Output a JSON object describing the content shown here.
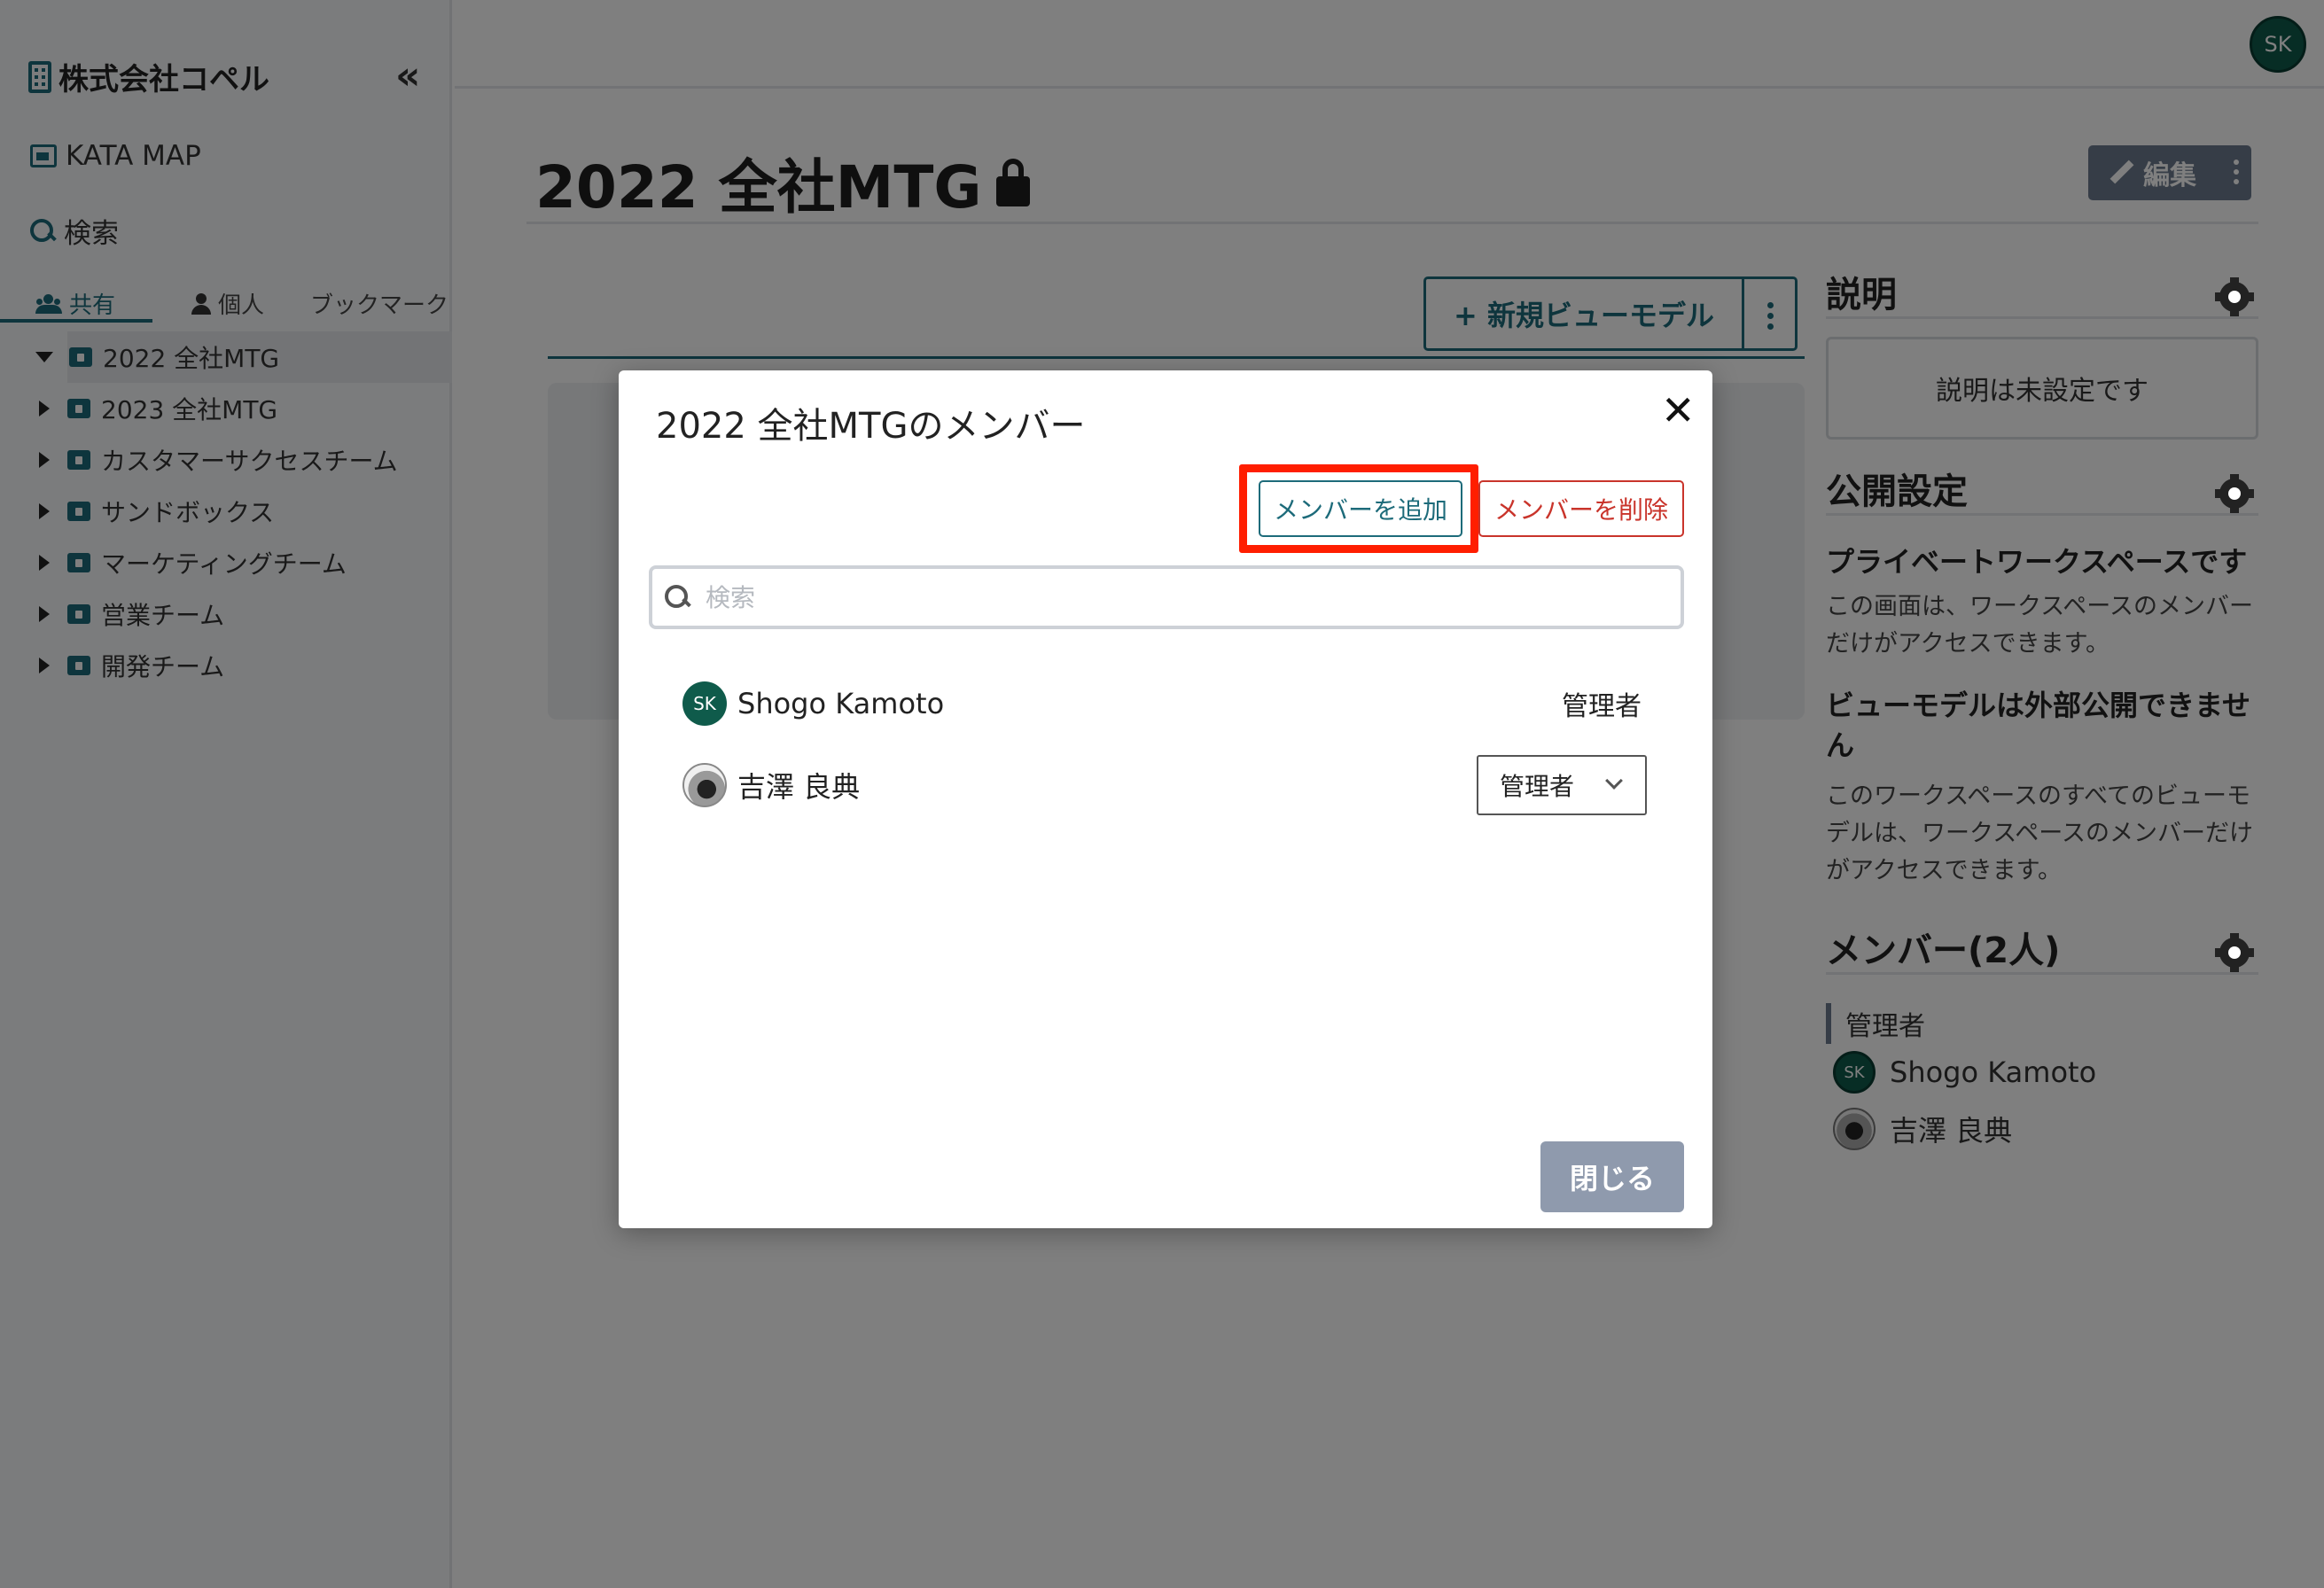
{
  "sidebar": {
    "org_name": "株式会社コペル",
    "collapse_glyph": "«",
    "kata_map": "KATA MAP",
    "search": "検索",
    "tabs": [
      {
        "label": "共有",
        "icon": "people-icon"
      },
      {
        "label": "個人",
        "icon": "person-icon"
      },
      {
        "label": "ブックマーク",
        "icon": ""
      }
    ],
    "tree": [
      {
        "label": "2022 全社MTG",
        "expanded": true,
        "active": true
      },
      {
        "label": "2023 全社MTG"
      },
      {
        "label": "カスタマーサクセスチーム"
      },
      {
        "label": "サンドボックス"
      },
      {
        "label": "マーケティングチーム"
      },
      {
        "label": "営業チーム"
      },
      {
        "label": "開発チーム"
      }
    ]
  },
  "topbar": {
    "avatar_initials": "SK"
  },
  "main": {
    "title": "2022 全社MTG",
    "edit_label": "編集",
    "new_view_label": "+ 新規ビューモデル"
  },
  "right_panel": {
    "description_heading": "説明",
    "description_empty": "説明は未設定です",
    "visibility_heading": "公開設定",
    "private_title": "プライベートワークスペースです",
    "private_text": "この画面は、ワークスペースのメンバーだけがアクセスできます。",
    "view_title": "ビューモデルは外部公開できません",
    "view_text": "このワークスペースのすべてのビューモデルは、ワークスペースのメンバーだけがアクセスできます。",
    "members_heading": "メンバー(2人)",
    "admin_label": "管理者",
    "members": [
      {
        "name": "Shogo Kamoto",
        "initials": "SK"
      },
      {
        "name": "吉澤 良典"
      }
    ]
  },
  "modal": {
    "title": "2022 全社MTGのメンバー",
    "close_glyph": "✕",
    "add_label": "メンバーを追加",
    "remove_label": "メンバーを削除",
    "search_placeholder": "検索",
    "members": [
      {
        "name": "Shogo Kamoto",
        "initials": "SK",
        "role": "管理者"
      },
      {
        "name": "吉澤 良典",
        "role": "管理者"
      }
    ],
    "close_label": "閉じる"
  },
  "colors": {
    "accent": "#1d6b7a",
    "danger": "#c9342b",
    "highlight": "#ff1e00",
    "avatar": "#0f5b4b"
  }
}
